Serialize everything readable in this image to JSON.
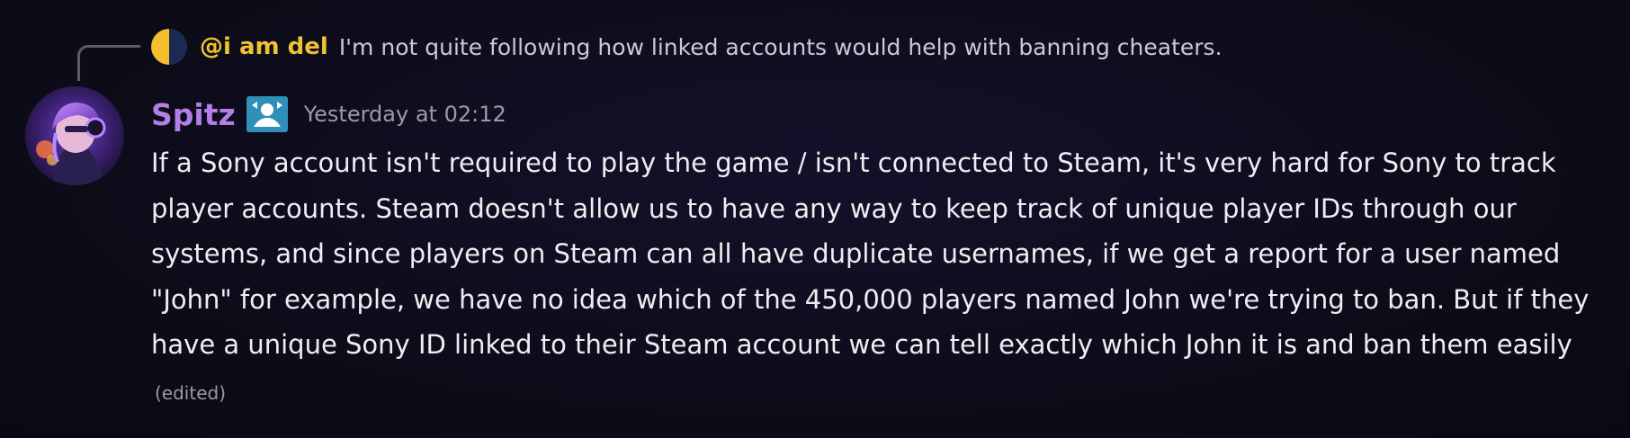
{
  "reply": {
    "author": "@i am del",
    "text": "I'm not quite following how linked accounts would help with banning cheaters."
  },
  "message": {
    "author": "Spitz",
    "timestamp": "Yesterday at 02:12",
    "content": "If a Sony account isn't required to play the game / isn't connected to Steam, it's very hard for Sony to track player accounts. Steam doesn't allow us to have any way to keep track of unique player IDs through our systems, and since players on Steam can all have duplicate usernames, if we get a report for a user named \"John\" for example, we have no idea which of the 450,000 players named John we're trying to ban. But if they have a unique Sony ID linked to their Steam account we can tell exactly which John it is and ban them easily",
    "edited_label": "(edited)"
  },
  "icons": {
    "reply_avatar": "half-yellow-half-navy-circle-avatar",
    "avatar": "character-portrait-avatar",
    "role_badge": "steam-role-badge-icon"
  },
  "colors": {
    "background": "#0d0c18",
    "reply_author": "#f0c233",
    "username": "#b37ee6",
    "timestamp": "#9a9ba6",
    "content": "#eeeef2",
    "badge": "#2f8fb8"
  }
}
